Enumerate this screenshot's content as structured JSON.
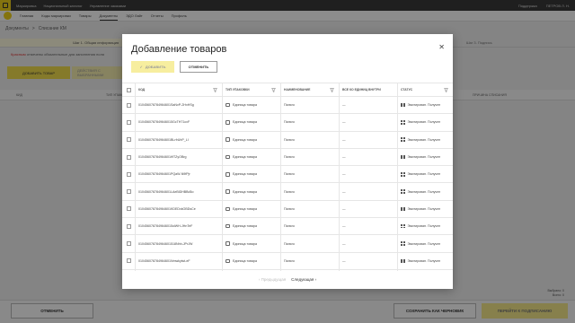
{
  "topbar": {
    "links": [
      "Маркировка",
      "Национальный каталог",
      "Управление заказами"
    ],
    "support": "Поддержка",
    "user": "ПЕТРОВ Л. Н."
  },
  "subnav": {
    "links": [
      "Главная",
      "Коды маркировки",
      "Товары",
      "Документы",
      "ЭДО Лайт",
      "Отчеты",
      "Профиль"
    ],
    "active_index": 3
  },
  "breadcrumb": {
    "section": "Документы",
    "separator": ">",
    "current": "Списание КМ"
  },
  "steps": [
    "Шаг 1. Общая информация",
    "",
    "Шаг 3. Подпись"
  ],
  "required_note": {
    "star": "Красным",
    "text": "отмечены обязательные для заполнения поля"
  },
  "background_buttons": {
    "add_goods": "ДОБАВИТЬ ТОВАР",
    "actions": "ДЕЙСТВИЯ С ВЫБРАННЫМИ"
  },
  "background_table_headers": [
    "КИД",
    "ТИП УПАКОВКИ",
    "ПРИЧИНА СПИСАНИЯ"
  ],
  "footer": {
    "cancel": "ОТМЕНИТЬ",
    "save_draft": "СОХРАНИТЬ КАК ЧЕРНОВИК",
    "sign": "ПЕРЕЙТИ К ПОДПИСАНИЮ"
  },
  "selection_count": {
    "selected": "Выбрано: 0",
    "total": "Всего: 0"
  },
  "modal": {
    "title": "Добавление товаров",
    "add_button": "ДОБАВИТЬ",
    "cancel_button": "ОТМЕНИТЬ",
    "columns": [
      "КОД",
      "ТИП УПАКОВКИ",
      "НАИМЕНОВАНИЕ",
      "ВСЕ КО ЕДИНИЦ ВНУТРИ",
      "СТАТУС"
    ],
    "rows": [
      {
        "code": "010456078784964601SaNvP-2HxHSg",
        "pack": "Единица товара",
        "name": "Пальто",
        "count": "—",
        "status": "Эмитирован. Получен"
      },
      {
        "code": "0104560787849646015GcTH71cxF",
        "pack": "Единица товара",
        "name": "Пальто",
        "count": "—",
        "status": "Эмитирован. Получен"
      },
      {
        "code": "010456078784964601BLrfrUhP_LI",
        "pack": "Единица товара",
        "name": "Пальто",
        "count": "—",
        "status": "Эмитирован. Получен"
      },
      {
        "code": "010456078784964601t9TZyOBrg",
        "pack": "Единица товара",
        "name": "Пальто",
        "count": "—",
        "status": "Эмитирован. Получен"
      },
      {
        "code": "010456078784964601PQaW-N9fPjr",
        "pack": "Единица товара",
        "name": "Пальто",
        "count": "—",
        "status": "Эмитирован. Получен"
      },
      {
        "code": "010456078784964601LAeBiDHBBd5o",
        "pack": "Единица товара",
        "name": "Пальто",
        "count": "—",
        "status": "Эмитирован. Получен"
      },
      {
        "code": "010456078784964601KDEDxkOBDsCe",
        "pack": "Единица товара",
        "name": "Пальто",
        "count": "—",
        "status": "Эмитирован. Получен"
      },
      {
        "code": "0104560787849646015oiWH-JHnTeF",
        "pack": "Единица товара",
        "name": "Пальто",
        "count": "—",
        "status": "Эмитирован. Получен"
      },
      {
        "code": "010456078784964601518Nhh-JPrJW",
        "pack": "Единица товара",
        "name": "Пальто",
        "count": "—",
        "status": "Эмитирован. Получен"
      },
      {
        "code": "010456078784964601Nmwkyiwt-eF",
        "pack": "Единица товара",
        "name": "Пальто",
        "count": "—",
        "status": "Эмитирован. Получен"
      }
    ],
    "pager": {
      "prev": "Предыдущая",
      "next": "Следующая"
    }
  },
  "colors": {
    "accent": "#f0d21c",
    "topbar": "#3a3a3a",
    "overlay": "rgba(0,0,0,0.45)"
  }
}
